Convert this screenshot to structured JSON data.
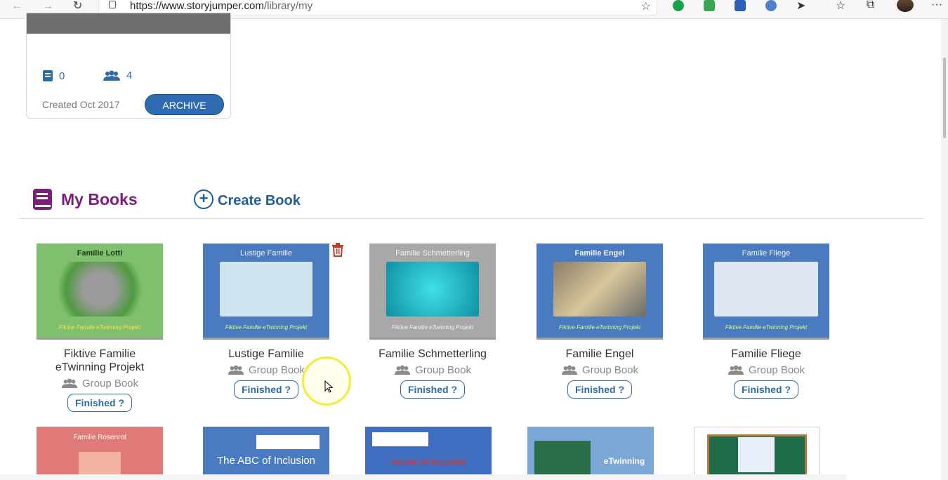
{
  "browser": {
    "url_host": "https://www.storyjumper.com",
    "url_path": "/library/my"
  },
  "group_card": {
    "books_count": "0",
    "members_count": "4",
    "created": "Created Oct 2017",
    "archive_label": "ARCHIVE"
  },
  "section": {
    "my_books": "My Books",
    "create_book": "Create Book"
  },
  "books": [
    {
      "title": "Fiktive Familie eTwinning Projekt",
      "type": "Group Book",
      "status": "Finished ?",
      "cover_title": "Familie Lotti",
      "cover_footer": "Fiktive Familie eTwinning Projekt",
      "cover_color": "#7fbf6e"
    },
    {
      "title": "Lustige Familie",
      "type": "Group Book",
      "status": "Finished ?",
      "cover_title": "Lustige Familie",
      "cover_footer": "Fiktive Familie eTwinning Projekt",
      "cover_color": "#4a7ac0"
    },
    {
      "title": "Familie Schmetterling",
      "type": "Group Book",
      "status": "Finished ?",
      "cover_title": "Familie Schmetterling",
      "cover_footer": "Fiktive Familie eTwinning Projekt",
      "cover_color": "#a8a8a8"
    },
    {
      "title": "Familie Engel",
      "type": "Group Book",
      "status": "Finished ?",
      "cover_title": "Familie Engel",
      "cover_footer": "Fiktive Familie eTwinning Projekt",
      "cover_color": "#4a7ac0"
    },
    {
      "title": "Familie Fliege",
      "type": "Group Book",
      "status": "Finished ?",
      "cover_title": "Familie Fliege",
      "cover_footer": "Fiktive Familie eTwinning Projekt",
      "cover_color": "#4a7ac0"
    }
  ],
  "row2_covers": [
    {
      "title": "Familie Rosenrot",
      "color": "#e07a78"
    },
    {
      "title": "The ABC of Inclusion",
      "color": "#4a7ac0"
    },
    {
      "title": "THE ABC OF INCLUSION",
      "color": "#3f6ec0"
    },
    {
      "title": "eTwinning",
      "color": "#7aa7d6"
    },
    {
      "title": "",
      "color": "#1f6b4a"
    }
  ],
  "colors": {
    "accent_blue": "#2e6ca6",
    "archive_blue": "#2f6bb0",
    "my_books_purple": "#7b1f7a",
    "trash_red": "#c0392b"
  }
}
